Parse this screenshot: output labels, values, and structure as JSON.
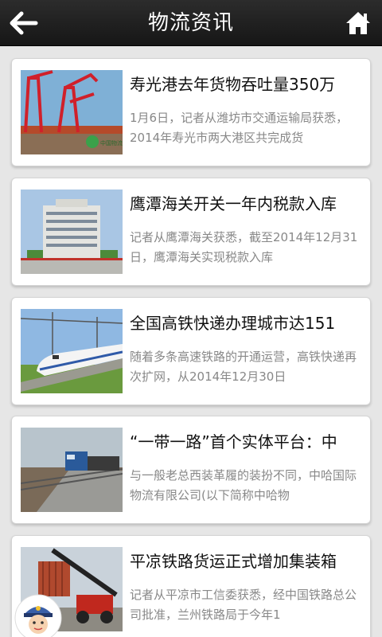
{
  "header": {
    "title": "物流资讯",
    "back_icon": "arrow-left-icon",
    "home_icon": "home-icon"
  },
  "articles": [
    {
      "title": "寿光港去年货物吞吐量350万",
      "summary": "1月6日，记者从潍坊市交通运输局获悉，2014年寿光市两大港区共完成货",
      "thumb_caption": "中国物流网"
    },
    {
      "title": "鹰潭海关开关一年内税款入库",
      "summary": "记者从鹰潭海关获悉，截至2014年12月31日，鹰潭海关实现税款入库"
    },
    {
      "title": "全国高铁快递办理城市达151",
      "summary": "随着多条高速铁路的开通运营，高铁快递再次扩网，从2014年12月30日"
    },
    {
      "title": "“一带一路”首个实体平台：中",
      "summary": "与一般老总西装革履的装扮不同，中哈国际物流有限公司(以下简称中哈物"
    },
    {
      "title": "平凉铁路货运正式增加集装箱",
      "summary": "记者从平凉市工信委获悉，经中国铁路总公司批准，兰州铁路局于今年1"
    }
  ],
  "colors": {
    "header_bg": "#1f1f1f",
    "page_bg": "#e6e6e6",
    "card_bg": "#ffffff",
    "title_text": "#111111",
    "summary_text": "#888888"
  }
}
